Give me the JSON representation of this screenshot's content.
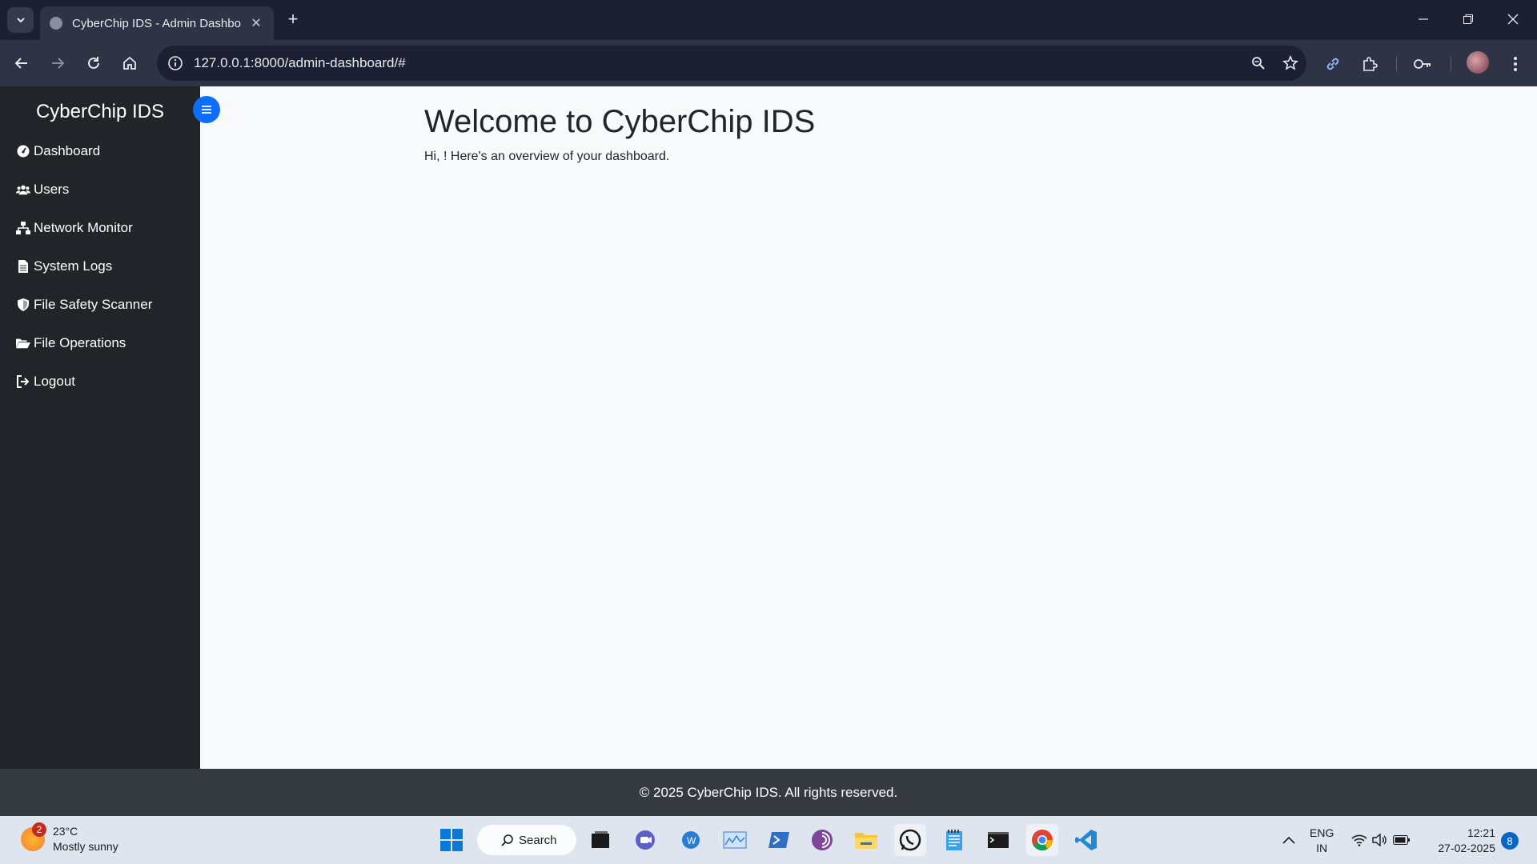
{
  "browser": {
    "tab_title": "CyberChip IDS - Admin Dashbo",
    "url": "127.0.0.1:8000/admin-dashboard/#"
  },
  "sidebar": {
    "brand": "CyberChip IDS",
    "items": [
      {
        "label": "Dashboard",
        "icon": "tachometer-icon"
      },
      {
        "label": "Users",
        "icon": "users-icon"
      },
      {
        "label": "Network Monitor",
        "icon": "network-icon"
      },
      {
        "label": "System Logs",
        "icon": "file-icon"
      },
      {
        "label": "File Safety Scanner",
        "icon": "shield-icon"
      },
      {
        "label": "File Operations",
        "icon": "folder-open-icon"
      },
      {
        "label": "Logout",
        "icon": "sign-out-icon"
      }
    ]
  },
  "main": {
    "heading": "Welcome to CyberChip IDS",
    "subtext": "Hi, ! Here's an overview of your dashboard."
  },
  "footer": {
    "text": "© 2025 CyberChip IDS. All rights reserved."
  },
  "taskbar": {
    "weather_badge": "2",
    "temperature": "23°C",
    "condition": "Mostly sunny",
    "search_label": "Search",
    "lang_top": "ENG",
    "lang_bottom": "IN",
    "time": "12:21",
    "date": "27-02-2025",
    "notification_count": "8"
  },
  "colors": {
    "sidebar_bg": "#212529",
    "content_bg": "#f8f9fa",
    "footer_bg": "#343a40",
    "toggle_accent": "#0d6efd"
  }
}
